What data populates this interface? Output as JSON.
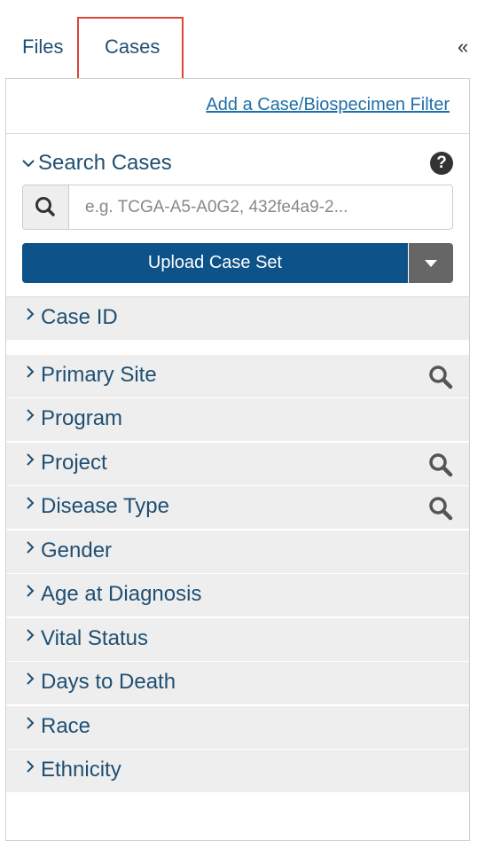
{
  "tabs": {
    "files_label": "Files",
    "cases_label": "Cases",
    "collapse_label": "«"
  },
  "panel": {
    "add_filter_link": "Add a Case/Biospecimen Filter",
    "search": {
      "title": "Search Cases",
      "placeholder": "e.g. TCGA-A5-A0G2, 432fe4a9-2...",
      "upload_label": "Upload Case Set"
    },
    "facets": [
      {
        "label": "Case ID",
        "has_search": false
      },
      {
        "label": "Primary Site",
        "has_search": true
      },
      {
        "label": "Program",
        "has_search": false
      },
      {
        "label": "Project",
        "has_search": true
      },
      {
        "label": "Disease Type",
        "has_search": true
      },
      {
        "label": "Gender",
        "has_search": false
      },
      {
        "label": "Age at Diagnosis",
        "has_search": false
      },
      {
        "label": "Vital Status",
        "has_search": false
      },
      {
        "label": "Days to Death",
        "has_search": false
      },
      {
        "label": "Race",
        "has_search": false
      },
      {
        "label": "Ethnicity",
        "has_search": false
      }
    ]
  },
  "icons": {
    "search": "search-icon",
    "help": "question-circle-icon",
    "chevron_down": "chevron-down-icon",
    "chevron_right": "chevron-right-icon",
    "caret_down": "caret-down-icon"
  },
  "colors": {
    "accent": "#0d5289",
    "link": "#1f6fa8",
    "text": "#1f4f73",
    "highlight_box": "#e0443a",
    "facet_bg": "#eeeeee"
  }
}
